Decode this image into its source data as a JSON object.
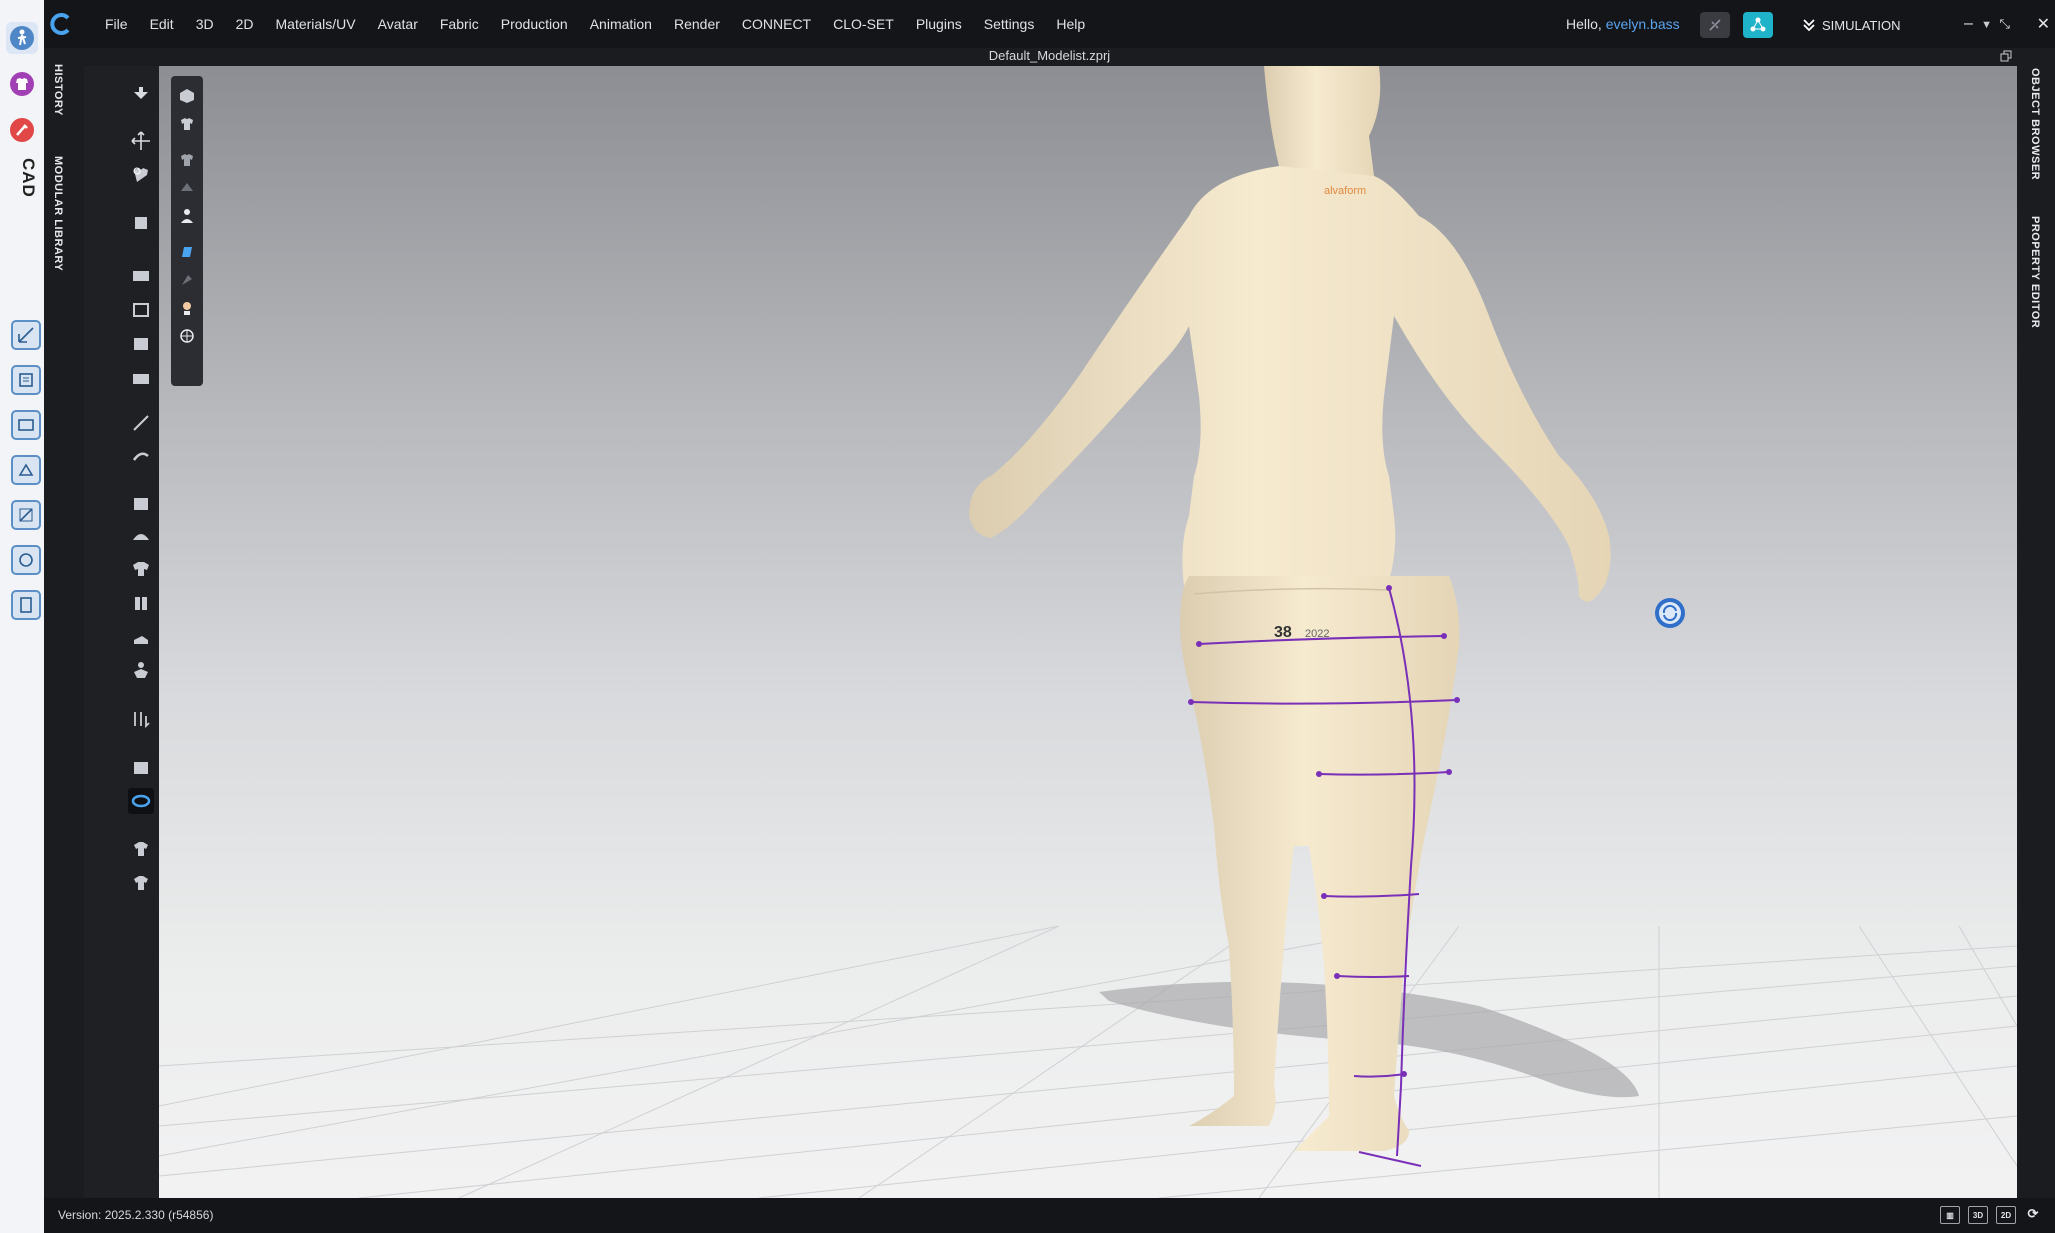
{
  "menubar": {
    "items": [
      "File",
      "Edit",
      "3D",
      "2D",
      "Materials/UV",
      "Avatar",
      "Fabric",
      "Production",
      "Animation",
      "Render",
      "CONNECT",
      "CLO-SET",
      "Plugins",
      "Settings",
      "Help"
    ],
    "greeting_prefix": "Hello,",
    "username": "evelyn.bass",
    "mode": "SIMULATION"
  },
  "document": {
    "title": "Default_Modelist.zprj"
  },
  "left_tabs": {
    "history": "HISTORY",
    "modular_library": "MODULAR LIBRARY"
  },
  "right_tabs": {
    "object_browser": "OBJECT BROWSER",
    "property_editor": "PROPERTY EDITOR"
  },
  "external": {
    "cad_label": "CAD"
  },
  "avatar": {
    "size_label": "38",
    "year_label": "2022",
    "brand_label": "alvaform"
  },
  "statusbar": {
    "version": "Version: 2025.2.330 (r54856)",
    "view_3d": "3D",
    "view_2d": "2D"
  },
  "colors": {
    "accent": "#5aa4ef",
    "measure_line": "#7a2fb8",
    "avatar_skin": "#f3e4c9",
    "sync_button": "#1fb3c9"
  }
}
